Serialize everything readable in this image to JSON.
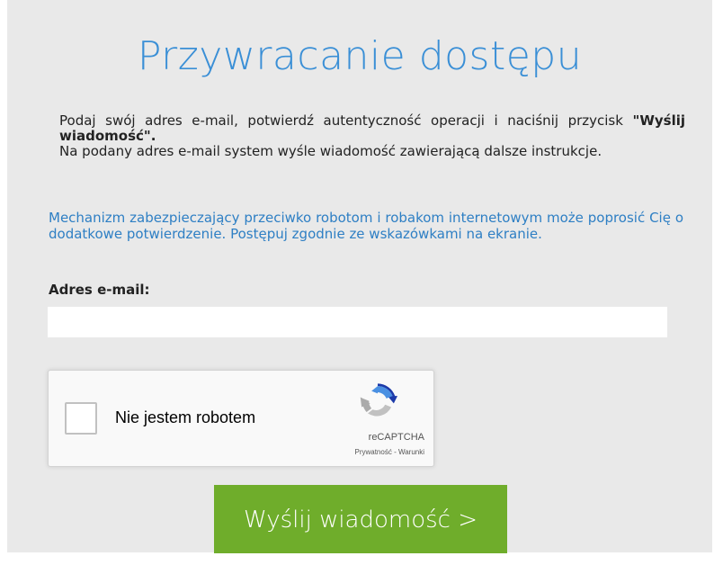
{
  "title": "Przywracanie dostępu",
  "instructions": {
    "line1_part1": "Podaj swój adres e-mail, potwierdź autentyczność operacji i naciśnij przycisk ",
    "line1_bold": "\"Wyślij wiadomość\".",
    "line2": "Na podany adres e-mail system wyśle wiadomość zawierającą dalsze instrukcje."
  },
  "robot_note": "Mechanizm zabezpieczający przeciwko robotom i robakom internetowym może poprosić Cię o dodatkowe potwierdzenie. Postępuj zgodnie ze wskazówkami na ekranie.",
  "email": {
    "label": "Adres e-mail:",
    "value": "",
    "placeholder": ""
  },
  "recaptcha": {
    "label": "Nie jestem robotem",
    "brand": "reCAPTCHA",
    "privacy_link": "Prywatność",
    "separator": " - ",
    "terms_link": "Warunki",
    "checked": false
  },
  "submit_button": "Wyślij wiadomość >",
  "colors": {
    "title": "#3a8fd6",
    "note": "#2e7fc4",
    "panel_bg": "#e9e9e9",
    "button_bg": "#6fad2b"
  }
}
